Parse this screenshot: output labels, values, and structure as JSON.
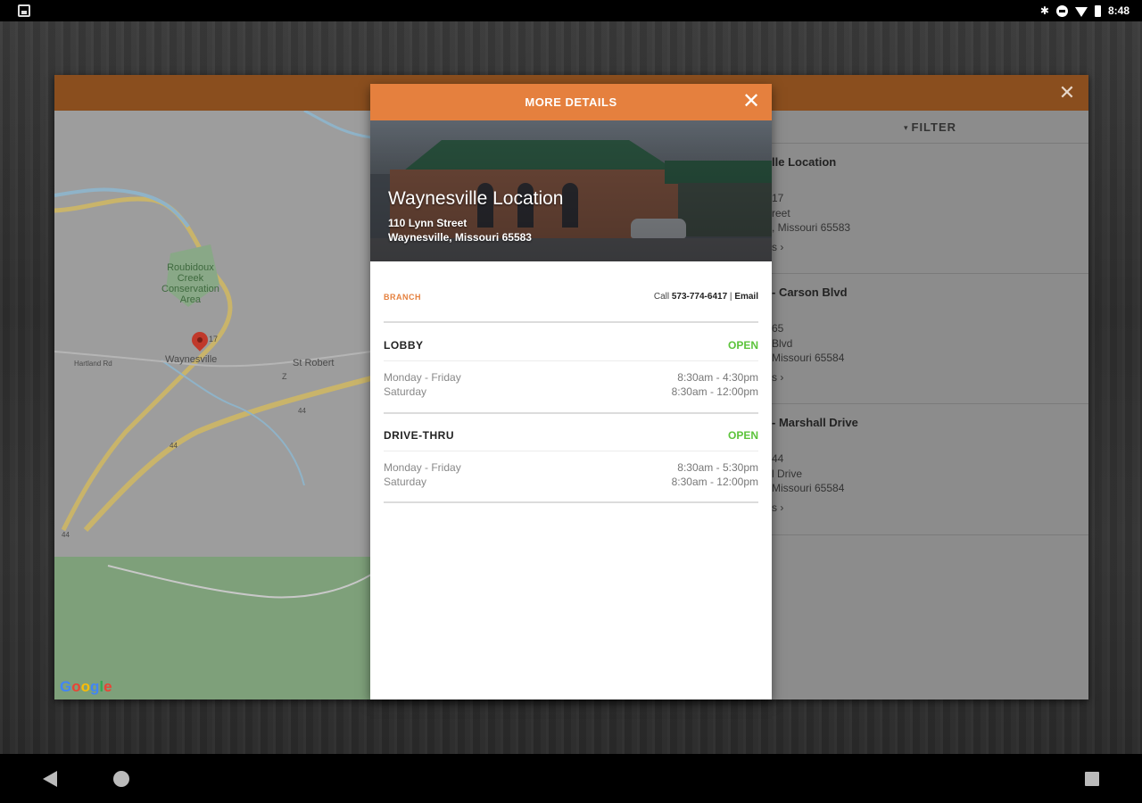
{
  "status_bar": {
    "time": "8:48",
    "bluetooth_glyph": "✱"
  },
  "map": {
    "labels": {
      "park": "Roubidoux\nCreek\nConservation\nArea",
      "city": "Waynesville",
      "town2": "St Robert",
      "street": "Hartland Rd",
      "hwy17": "17",
      "hwy44a": "44",
      "hwy44b": "44",
      "hwy44c": "44",
      "hwyX": "Z"
    },
    "google_logo": [
      "G",
      "o",
      "o",
      "g",
      "l",
      "e"
    ],
    "google_colors": [
      "#4285f4",
      "#ea4335",
      "#fbbc05",
      "#4285f4",
      "#34a853",
      "#ea4335"
    ]
  },
  "list": {
    "filter_label": "FILTER",
    "items": [
      {
        "title": "lle Location",
        "line1": "17",
        "line2": "reet",
        "line3": ", Missouri 65583",
        "more": "s ›"
      },
      {
        "title": "- Carson Blvd",
        "line1": "65",
        "line2": "Blvd",
        "line3": "Missouri 65584",
        "more": "s ›"
      },
      {
        "title": "- Marshall Drive",
        "line1": "44",
        "line2": "l Drive",
        "line3": "Missouri 65584",
        "more": "s ›"
      }
    ]
  },
  "details": {
    "title": "MORE DETAILS",
    "location_name": "Waynesville Location",
    "address_line1": "110 Lynn Street",
    "address_line2": "Waynesville, Missouri 65583",
    "branch_label": "BRANCH",
    "call_prefix": "Call",
    "phone": "573-774-6417",
    "separator": "|",
    "email": "Email",
    "sections": [
      {
        "title": "LOBBY",
        "status": "OPEN",
        "rows": [
          {
            "days": "Monday - Friday",
            "hours": "8:30am - 4:30pm"
          },
          {
            "days": "Saturday",
            "hours": "8:30am - 12:00pm"
          }
        ]
      },
      {
        "title": "DRIVE-THRU",
        "status": "OPEN",
        "rows": [
          {
            "days": "Monday - Friday",
            "hours": "8:30am - 5:30pm"
          },
          {
            "days": "Saturday",
            "hours": "8:30am - 12:00pm"
          }
        ]
      }
    ]
  },
  "colors": {
    "accent": "#e5803e",
    "accent_dark": "#8a4e1e",
    "open_green": "#5cc33b"
  },
  "icons": {
    "close": "close-icon",
    "filter_chevron": "chevron-down-icon",
    "map_pin": "map-pin-icon"
  }
}
